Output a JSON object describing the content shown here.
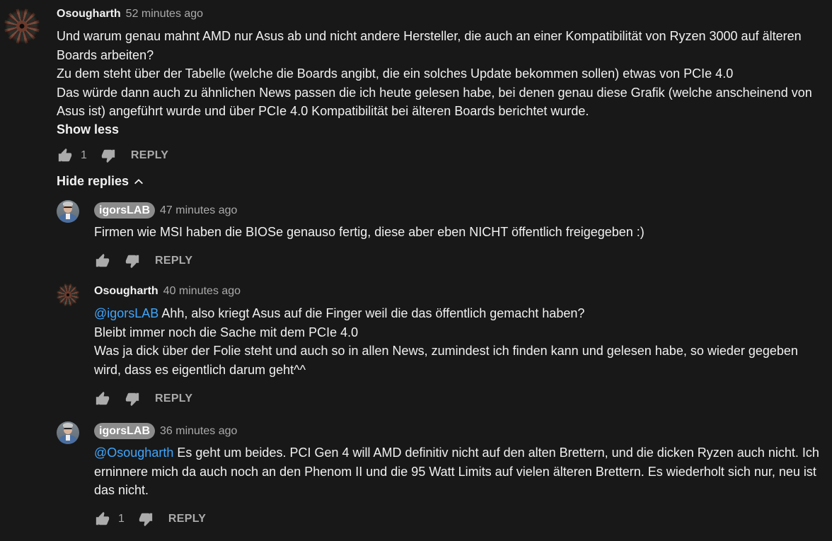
{
  "main_comment": {
    "author": "Osougharth",
    "time": "52 minutes ago",
    "lines": [
      "Und warum genau mahnt AMD nur Asus ab und nicht andere Hersteller, die auch an einer Kompatibilität von Ryzen 3000 auf älteren Boards arbeiten?",
      "Zu dem steht über der Tabelle (welche die Boards angibt, die ein solches Update bekommen sollen) etwas von PCIe 4.0",
      "Das würde dann auch zu ähnlichen News passen die ich heute gelesen habe, bei denen genau diese Grafik (welche anscheinend von Asus ist) angeführt wurde und über PCIe 4.0 Kompatibilität bei älteren Boards berichtet wurde."
    ],
    "show_less": "Show less",
    "likes": "1",
    "reply": "REPLY"
  },
  "hide_replies": "Hide replies",
  "replies": [
    {
      "author": "igorsLAB",
      "time": "47 minutes ago",
      "mention": "",
      "lines": [
        "Firmen wie MSI haben die BIOSe genauso fertig, diese aber eben NICHT öffentlich freigegeben :)"
      ],
      "likes": "",
      "reply": "REPLY"
    },
    {
      "author": "Osougharth",
      "time": "40 minutes ago",
      "mention": "@igorsLAB",
      "lines": [
        "Ahh, also kriegt Asus auf die Finger weil die das öffentlich gemacht haben?",
        "Bleibt immer noch die Sache mit dem PCIe 4.0",
        "Was ja dick über der Folie steht und auch so in allen News, zumindest ich finden kann und gelesen habe, so wieder gegeben wird, dass es eigentlich darum geht^^"
      ],
      "likes": "",
      "reply": "REPLY"
    },
    {
      "author": "igorsLAB",
      "time": "36 minutes ago",
      "mention": "@Osougharth",
      "lines": [
        "Es geht um beides. PCI Gen 4 will AMD definitiv nicht auf den alten Brettern,  und die dicken Ryzen auch nicht. Ich erninnere mich da auch noch an den Phenom II und die 95 Watt Limits auf vielen älteren Brettern. Es wiederholt sich nur, neu ist das nicht."
      ],
      "likes": "1",
      "reply": "REPLY"
    }
  ],
  "colors": {
    "background": "#181818",
    "text": "#f1f1f1",
    "secondary": "#aaaaaa",
    "mention": "#3ea6ff",
    "badge": "#8c8c8c"
  },
  "icons": [
    "thumb-up-icon",
    "thumb-down-icon",
    "chevron-up-icon"
  ]
}
